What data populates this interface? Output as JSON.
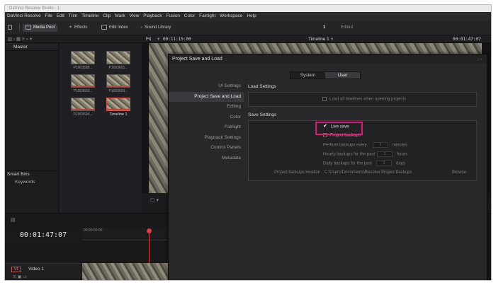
{
  "app": {
    "title": "DaVinci Resolve Studio - 1"
  },
  "menu": [
    "DaVinci Resolve",
    "File",
    "Edit",
    "Trim",
    "Timeline",
    "Clip",
    "Mark",
    "View",
    "Playback",
    "Fusion",
    "Color",
    "Fairlight",
    "Workspace",
    "Help"
  ],
  "toolbar": {
    "media_pool": "Media Pool",
    "effects": "Effects",
    "edit_index": "Edit Index",
    "sound_library": "Sound Library",
    "project_num": "1",
    "edited": "Edited"
  },
  "toolbar2": {
    "fit": "Fit",
    "timecode_left": "00:11:15:00",
    "timeline_name": "Timeline 1",
    "timecode_right": "00:01:47:07"
  },
  "left_panel": {
    "master": "Master",
    "smart_bins": "Smart Bins",
    "keywords": "Keywords"
  },
  "media_clips": [
    {
      "name": "P1003598...",
      "selected": false
    },
    {
      "name": "P1003601...",
      "selected": false
    },
    {
      "name": "P1003602...",
      "selected": false
    },
    {
      "name": "P1003603...",
      "selected": false
    },
    {
      "name": "P1003604...",
      "selected": false
    },
    {
      "name": "Timeline 1",
      "selected": true
    }
  ],
  "timeline": {
    "timecode": "00:01:47:07",
    "ruler_label": "00:00:00:00",
    "track_badge": "V1",
    "track_name": "Video 1"
  },
  "dialog": {
    "title": "Project Save and Load",
    "dots": "···",
    "tabs": [
      {
        "label": "System",
        "active": false
      },
      {
        "label": "User",
        "active": true
      }
    ],
    "nav": [
      {
        "label": "UI Settings",
        "current": false
      },
      {
        "label": "Project Save and Load",
        "current": true
      },
      {
        "label": "Editing",
        "current": false
      },
      {
        "label": "Color",
        "current": false
      },
      {
        "label": "Fairlight",
        "current": false
      },
      {
        "label": "Playback Settings",
        "current": false
      },
      {
        "label": "Control Panels",
        "current": false
      },
      {
        "label": "Metadata",
        "current": false
      }
    ],
    "load_settings_title": "Load Settings",
    "load_all_timelines": "Load all timelines when opening projects",
    "save_settings_title": "Save Settings",
    "live_save": "Live save",
    "project_backups": "Project backups",
    "perform_backups": "Perform backups every",
    "perform_backups_value": "1",
    "perform_backups_unit": "minutes",
    "hourly_backups": "Hourly backups for the past",
    "hourly_backups_value": "2",
    "hourly_backups_unit": "hours",
    "daily_backups": "Daily backups for the past",
    "daily_backups_value": "1",
    "daily_backups_unit": "days",
    "backups_location_label": "Project backups location",
    "backups_location_path": "C:\\Users\\Documents\\Resolve Project Backups",
    "browse": "Browse"
  },
  "colors": {
    "accent_highlight": "#e0187a",
    "playhead": "#e03c3c"
  }
}
